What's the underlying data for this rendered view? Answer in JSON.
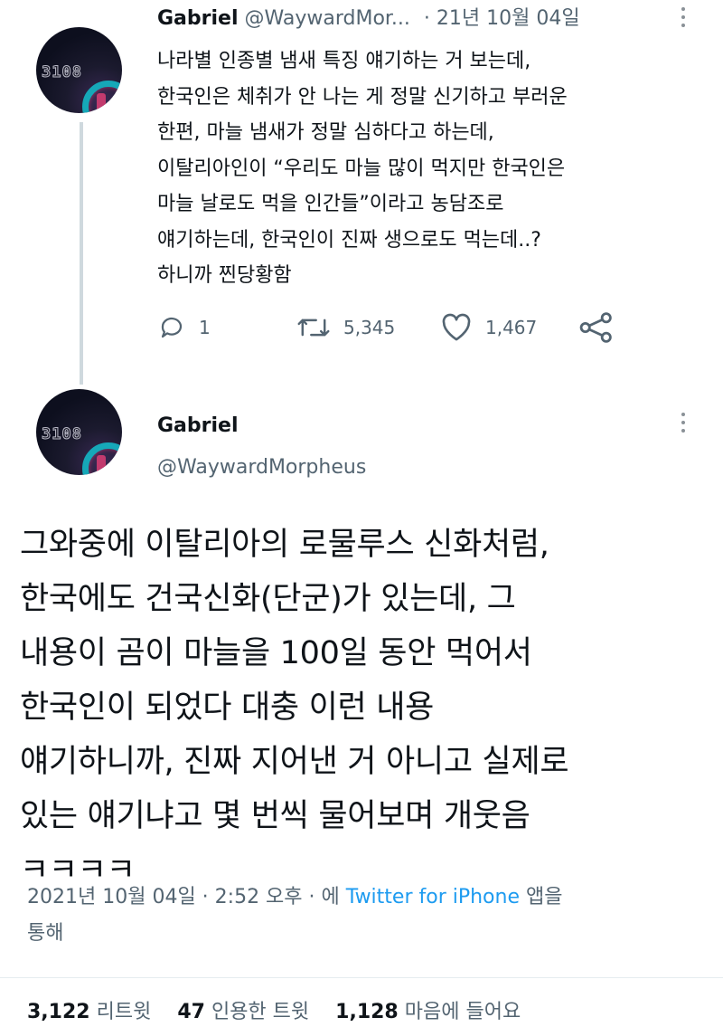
{
  "tweet1": {
    "display_name": "Gabriel",
    "handle": "@WaywardMor...",
    "separator": "·",
    "date": "21년 10월 04일",
    "avatar_text": "3108",
    "text": "나라별 인종별 냄새 특징 얘기하는 거 보는데,\n한국인은 체취가 안 나는 게 정말 신기하고 부러운\n한편, 마늘 냄새가 정말 심하다고 하는데,\n이탈리아인이 “우리도 마늘 많이 먹지만 한국인은\n마늘 날로도 먹을 인간들”이라고 농담조로\n얘기하는데, 한국인이 진짜 생으로도 먹는데..?\n하니까 찐당황함",
    "replies": "1",
    "retweets": "5,345",
    "likes": "1,467"
  },
  "tweet2": {
    "display_name": "Gabriel",
    "handle": "@WaywardMorpheus",
    "avatar_text": "3108",
    "text": "그와중에 이탈리아의 로물루스 신화처럼,\n한국에도 건국신화(단군)가 있는데, 그\n내용이 곰이 마늘을 100일 동안 먹어서\n한국인이 되었다 대충 이런 내용\n얘기하니까, 진짜 지어낸 거 아니고 실제로\n있는 얘기냐고 몇 번씩 물어보며 개웃음\nㅋㅋㅋㅋ",
    "timestamp": "2021년 10월 04일 · 2:52 오후 · 에",
    "source": "Twitter for iPhone",
    "source_suffix": "앱을",
    "source_suffix2": "통해",
    "retweets": "3,122",
    "retweets_label": "리트윗",
    "quotes": "47",
    "quotes_label": "인용한 트윗",
    "likes": "1,128",
    "likes_label": "마음에 들어요"
  },
  "colors": {
    "text": "#0f1419",
    "muted": "#536471",
    "link": "#1d9bf0",
    "thread_line": "#cfd9de"
  }
}
